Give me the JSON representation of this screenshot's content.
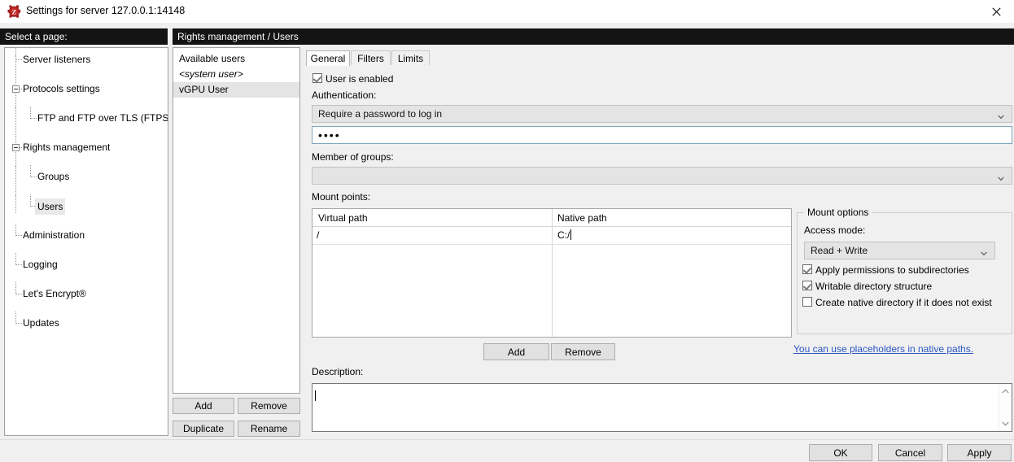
{
  "window": {
    "title": "Settings for server 127.0.0.1:14148",
    "icon": "filezilla-icon",
    "close_label": "✕"
  },
  "headers": {
    "left": "Select a page:",
    "right": "Rights management / Users"
  },
  "tree": {
    "items": [
      {
        "label": "Server listeners",
        "depth": 1,
        "selected": false,
        "expander": false
      },
      {
        "label": "Protocols settings",
        "depth": 1,
        "selected": false,
        "expander": true
      },
      {
        "label": "FTP and FTP over TLS (FTPS)",
        "depth": 2,
        "selected": false,
        "expander": false
      },
      {
        "label": "Rights management",
        "depth": 1,
        "selected": false,
        "expander": true
      },
      {
        "label": "Groups",
        "depth": 2,
        "selected": false,
        "expander": false
      },
      {
        "label": "Users",
        "depth": 2,
        "selected": true,
        "expander": false
      },
      {
        "label": "Administration",
        "depth": 1,
        "selected": false,
        "expander": false
      },
      {
        "label": "Logging",
        "depth": 1,
        "selected": false,
        "expander": false
      },
      {
        "label": "Let's Encrypt®",
        "depth": 1,
        "selected": false,
        "expander": false
      },
      {
        "label": "Updates",
        "depth": 1,
        "selected": false,
        "expander": false
      }
    ]
  },
  "users": {
    "title": "Available users",
    "items": [
      {
        "label": "<system user>",
        "italic": true,
        "selected": false
      },
      {
        "label": "vGPU User",
        "italic": false,
        "selected": true
      }
    ],
    "buttons": {
      "add": "Add",
      "remove": "Remove",
      "duplicate": "Duplicate",
      "rename": "Rename"
    }
  },
  "tabs": [
    {
      "label": "General",
      "active": true
    },
    {
      "label": "Filters",
      "active": false
    },
    {
      "label": "Limits",
      "active": false
    }
  ],
  "general": {
    "user_enabled": {
      "label": "User is enabled",
      "checked": true
    },
    "authentication_label": "Authentication:",
    "authentication_value": "Require a password to log in",
    "password_value": "••••",
    "member_of_groups_label": "Member of groups:",
    "member_of_groups_value": "",
    "mount_points_label": "Mount points:",
    "description_label": "Description:",
    "description_value": ""
  },
  "mount_grid": {
    "columns": [
      "Virtual path",
      "Native path"
    ],
    "rows": [
      {
        "virtual_path": "/",
        "native_path": "C:/"
      }
    ],
    "buttons": {
      "add": "Add",
      "remove": "Remove"
    }
  },
  "mount_options": {
    "title": "Mount options",
    "access_mode_label": "Access mode:",
    "access_mode_value": "Read + Write",
    "checkboxes": [
      {
        "label": "Apply permissions to subdirectories",
        "checked": true
      },
      {
        "label": "Writable directory structure",
        "checked": true
      },
      {
        "label": "Create native directory if it does not exist",
        "checked": false
      }
    ],
    "link": "You can use placeholders in native paths."
  },
  "dialog_buttons": {
    "ok": "OK",
    "cancel": "Cancel",
    "apply": "Apply"
  },
  "colors": {
    "header_bg": "#141414",
    "link": "#2b56c4",
    "selection": "#e4e4e4",
    "button_face": "#e1e1e1"
  }
}
